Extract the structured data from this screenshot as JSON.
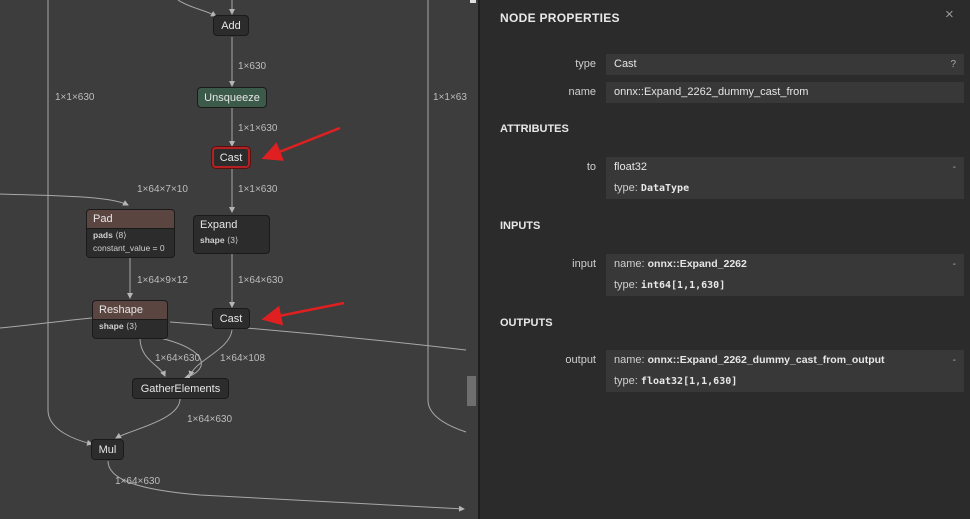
{
  "graph": {
    "nodes": {
      "add": "Add",
      "unsqueeze": "Unsqueeze",
      "cast_selected": "Cast",
      "pad": "Pad",
      "pad_attr1_name": "pads",
      "pad_attr1_value": "⟨8⟩",
      "pad_attr2": "constant_value = 0",
      "expand": "Expand",
      "expand_attr_name": "shape",
      "expand_attr_value": "⟨3⟩",
      "reshape": "Reshape",
      "reshape_attr_name": "shape",
      "reshape_attr_value": "⟨3⟩",
      "cast2": "Cast",
      "gather_elements": "GatherElements",
      "mul": "Mul"
    },
    "edge_labels": {
      "add_unsqueeze": "1×630",
      "left_long": "1×1×630",
      "right_long": "1×1×63",
      "unsqueeze_cast": "1×1×630",
      "pad_in": "1×64×7×10",
      "cast_expand": "1×1×630",
      "pad_reshape": "1×64×9×12",
      "expand_cast": "1×64×630",
      "reshape_gather": "1×64×630",
      "cast_gather": "1×64×108",
      "gather_mul": "1×64×630",
      "mul_out": "1×64×630"
    },
    "colors": {
      "arrow": "#e02020",
      "selected_border": "#b22222",
      "unsqueeze_header": "#3b5a4a",
      "layer_header": "#5b4540"
    }
  },
  "panel": {
    "title": "NODE PROPERTIES",
    "close_icon": "×",
    "type_label": "type",
    "type_value": "Cast",
    "type_help": "?",
    "name_label": "name",
    "name_value": "onnx::Expand_2262_dummy_cast_from",
    "attributes_heading": "ATTRIBUTES",
    "attr_to_label": "to",
    "attr_to_value": "float32",
    "attr_to_dash": "-",
    "attr_to_type_key": "type:",
    "attr_to_type_value": "DataType",
    "inputs_heading": "INPUTS",
    "input_label": "input",
    "input_name_key": "name:",
    "input_name_value": "onnx::Expand_2262",
    "input_dash": "-",
    "input_type_key": "type:",
    "input_type_value": "int64[1,1,630]",
    "outputs_heading": "OUTPUTS",
    "output_label": "output",
    "output_name_key": "name:",
    "output_name_value": "onnx::Expand_2262_dummy_cast_from_output",
    "output_dash": "-",
    "output_type_key": "type:",
    "output_type_value": "float32[1,1,630]"
  }
}
